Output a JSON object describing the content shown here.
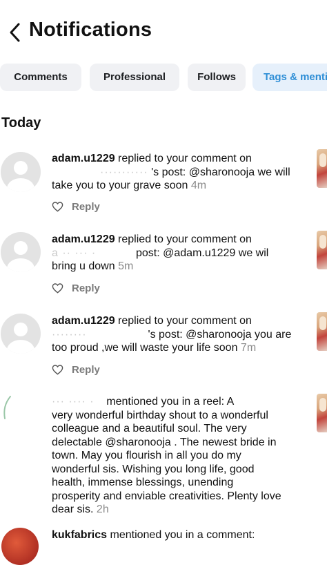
{
  "header": {
    "title": "Notifications"
  },
  "tabs": [
    {
      "label": "Comments"
    },
    {
      "label": "Professional"
    },
    {
      "label": "Follows"
    },
    {
      "label": "Tags & menti"
    }
  ],
  "section": {
    "title": "Today"
  },
  "notifications": [
    {
      "user": "adam.u1229",
      "action": " replied to your comment on",
      "line2_obscured": "···········",
      "line2": "'s post: @sharonooja we will",
      "line3": "take you to your grave soon ",
      "time": "4m",
      "reply": "Reply"
    },
    {
      "user": "adam.u1229",
      "action": " replied to your comment on",
      "line2_obscured": "a ·· ··· ·",
      "line2": "post: @adam.u1229 we wil",
      "line3": "bring u down ",
      "time": "5m",
      "reply": "Reply"
    },
    {
      "user": "adam.u1229",
      "action": " replied to your comment on",
      "line2_obscured": "········",
      "line2": "'s post: @sharonooja you are",
      "line3": "too proud ,we will waste your life soon ",
      "time": "7m",
      "reply": "Reply"
    },
    {
      "user_obscured": "··· ···· ·",
      "line1": "mentioned you in a reel: A",
      "lines": [
        "very wonderful birthday shout to a wonderful",
        "colleague and a beautiful soul. The very",
        "delectable @sharonooja . The newest bride in",
        "town. May you flourish in all you do my",
        "wonderful sis. Wishing you long life, good",
        "health, immense blessings, unending",
        "prosperity and enviable creativities. Plenty love"
      ],
      "last_line": "dear sis. ",
      "time": "2h"
    },
    {
      "user": "kukfabrics",
      "action": " mentioned you in a comment:"
    }
  ]
}
